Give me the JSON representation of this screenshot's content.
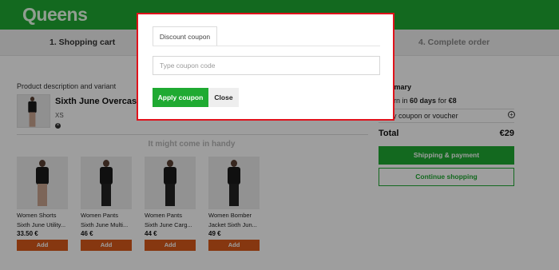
{
  "header": {
    "logo": "Queens"
  },
  "steps": {
    "step1": "1. Shopping cart",
    "step4": "4. Complete order"
  },
  "cart": {
    "column_header": "Product description and variant",
    "item": {
      "title": "Sixth June Overcast Set",
      "size": "XS"
    }
  },
  "recommendations": {
    "heading": "It might come in handy",
    "add_label": "Add",
    "items": [
      {
        "category": "Women Shorts",
        "name": "Sixth June Utility...",
        "price": "33.50 €"
      },
      {
        "category": "Women Pants",
        "name": "Sixth June Multi...",
        "price": "46 €"
      },
      {
        "category": "Women Pants",
        "name": "Sixth June Carg...",
        "price": "44 €"
      },
      {
        "category": "Women Bomber",
        "name": "Jacket Sixth Jun...",
        "price": "49 €"
      }
    ]
  },
  "summary": {
    "title": "Summary",
    "return_prefix": "Return in ",
    "return_days": "60 days",
    "return_mid": " for ",
    "return_price": "€8",
    "coupon_link": "Apply coupon or voucher",
    "total_label": "Total",
    "total_value": "€29",
    "shipping_button": "Shipping & payment",
    "continue_button": "Continue shopping"
  },
  "modal": {
    "tab_label": "Discount coupon",
    "input_placeholder": "Type coupon code",
    "input_value": "",
    "apply_button": "Apply coupon",
    "close_button": "Close"
  },
  "colors": {
    "brand_green": "#1faa32",
    "add_orange": "#d9591a",
    "modal_border": "#e0121b"
  }
}
